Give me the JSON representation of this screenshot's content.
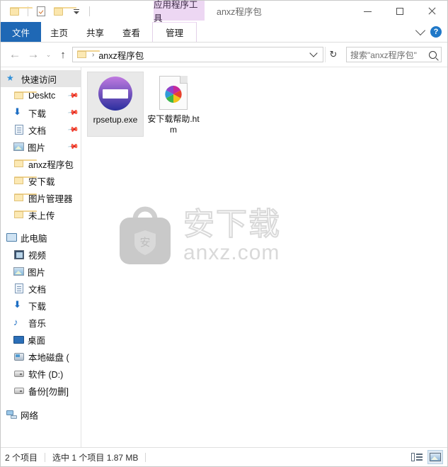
{
  "window": {
    "title": "anxz程序包",
    "contextual_tab_header": "应用程序工具",
    "minimize_label": "最小化",
    "maximize_label": "最大化",
    "close_label": "关闭"
  },
  "quick_access_toolbar": {
    "items": [
      {
        "icon": "folder-icon",
        "label": "属性文件夹"
      },
      {
        "icon": "properties-icon",
        "label": "属性"
      },
      {
        "icon": "folder-icon",
        "label": "新建文件夹"
      },
      {
        "icon": "customize-caret-icon",
        "label": "自定义快速访问工具栏"
      }
    ]
  },
  "ribbon": {
    "tabs": [
      {
        "label": "文件",
        "active": true
      },
      {
        "label": "主页",
        "active": false
      },
      {
        "label": "共享",
        "active": false
      },
      {
        "label": "查看",
        "active": false
      }
    ],
    "contextual_tab": {
      "label": "管理"
    },
    "expand_label": "展开功能区",
    "help_label": "?"
  },
  "navigation": {
    "back_label": "←",
    "forward_label": "→",
    "recent_label": "⌄",
    "up_label": "↑",
    "refresh_label": "↻",
    "address": {
      "crumb": "anxz程序包",
      "separator": "›",
      "dropdown_label": "⌄"
    },
    "search": {
      "placeholder": "搜索\"anxz程序包\"",
      "icon": "search-icon"
    }
  },
  "sidebar": {
    "groups": [
      {
        "header": {
          "label": "快速访问",
          "icon": "star-pin-icon",
          "selected": true
        },
        "items": [
          {
            "label": "Desktc",
            "icon": "folder-icon",
            "pinned": true
          },
          {
            "label": "下载",
            "icon": "download-icon",
            "pinned": true
          },
          {
            "label": "文档",
            "icon": "document-icon",
            "pinned": true
          },
          {
            "label": "图片",
            "icon": "picture-icon",
            "pinned": true
          },
          {
            "label": "anxz程序包",
            "icon": "folder-icon",
            "pinned": false
          },
          {
            "label": "安下载",
            "icon": "folder-icon",
            "pinned": false
          },
          {
            "label": "图片管理器",
            "icon": "folder-icon",
            "pinned": false
          },
          {
            "label": "未上传",
            "icon": "folder-icon",
            "pinned": false
          }
        ]
      },
      {
        "header": {
          "label": "此电脑",
          "icon": "this-pc-icon",
          "selected": false
        },
        "items": [
          {
            "label": "视频",
            "icon": "video-icon",
            "pinned": false
          },
          {
            "label": "图片",
            "icon": "picture-icon",
            "pinned": false
          },
          {
            "label": "文档",
            "icon": "document-icon",
            "pinned": false
          },
          {
            "label": "下载",
            "icon": "download-icon",
            "pinned": false
          },
          {
            "label": "音乐",
            "icon": "music-icon",
            "pinned": false
          },
          {
            "label": "桌面",
            "icon": "desktop-icon",
            "pinned": false
          },
          {
            "label": "本地磁盘 (",
            "icon": "system-drive-icon",
            "pinned": false
          },
          {
            "label": "软件 (D:)",
            "icon": "drive-icon",
            "pinned": false
          },
          {
            "label": "备份[勿删]",
            "icon": "drive-icon",
            "pinned": false
          }
        ]
      },
      {
        "header": {
          "label": "网络",
          "icon": "network-icon",
          "selected": false
        },
        "items": []
      }
    ]
  },
  "files": [
    {
      "name": "rpsetup.exe",
      "icon": "exe-icon",
      "selected": true
    },
    {
      "name": "安下载帮助.htm",
      "icon": "html-icon",
      "selected": false
    }
  ],
  "watermark": {
    "cn_text": "安下载",
    "en_text": "anxz.com",
    "logo_glyph": "安"
  },
  "statusbar": {
    "item_count": "2 个项目",
    "selection": "选中 1 个项目  1.87 MB",
    "views": [
      {
        "name": "details-view",
        "label": "详细信息",
        "active": false
      },
      {
        "name": "large-icons-view",
        "label": "大图标",
        "active": true
      }
    ]
  },
  "colors": {
    "accent": "#1f68b5",
    "contextual_tab": "#edd7f3",
    "selection": "#e9e9e9",
    "help_blue": "#1f78c8"
  }
}
